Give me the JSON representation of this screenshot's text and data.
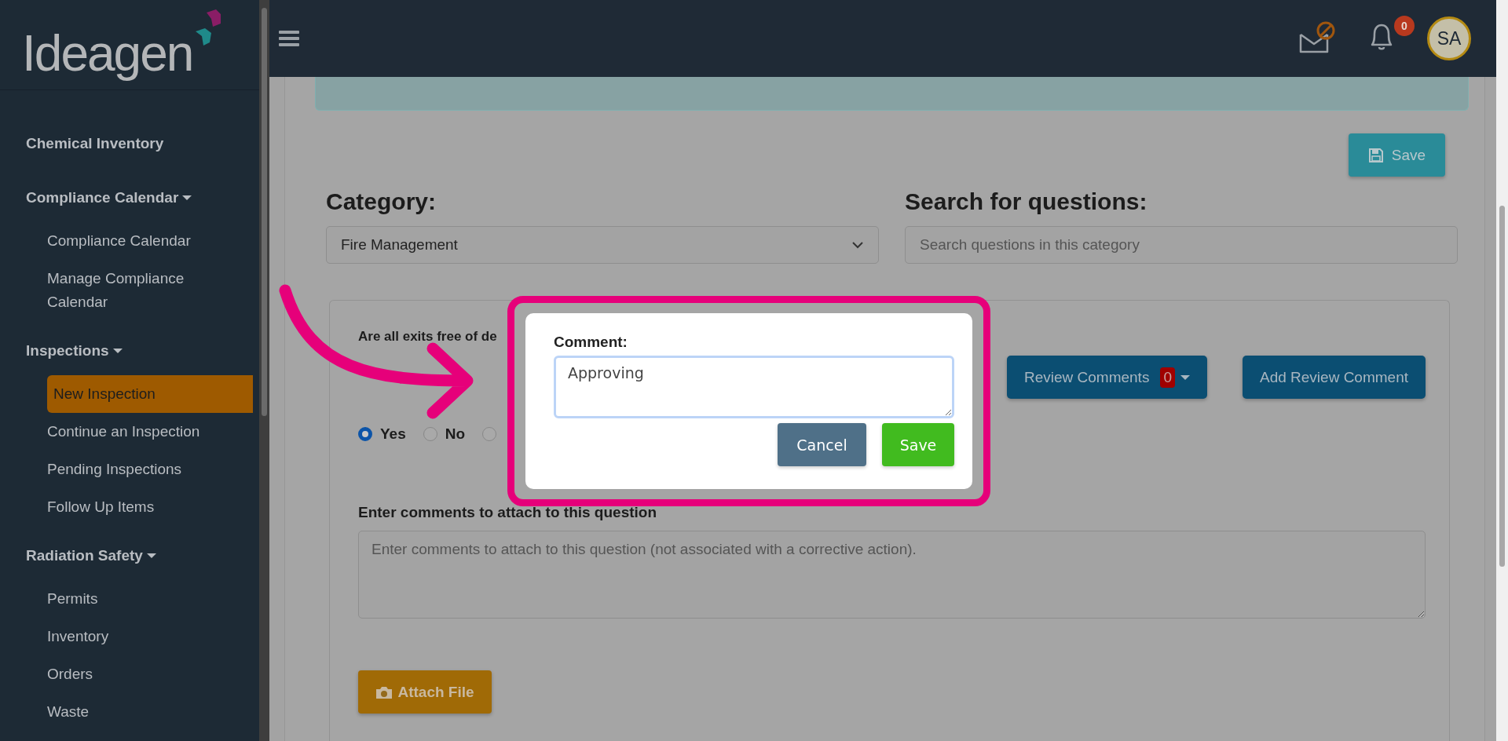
{
  "sidebar": {
    "logo": "Ideagen",
    "sections": [
      {
        "label": "Chemical Inventory",
        "kind": "link"
      },
      {
        "label": "Compliance Calendar",
        "kind": "group",
        "children": [
          {
            "label": "Compliance Calendar",
            "selected": false
          },
          {
            "label": "Manage Compliance Calendar",
            "selected": false
          }
        ]
      },
      {
        "label": "Inspections",
        "kind": "group",
        "children": [
          {
            "label": "New Inspection",
            "selected": true
          },
          {
            "label": "Continue an Inspection",
            "selected": false
          },
          {
            "label": "Pending Inspections",
            "selected": false
          },
          {
            "label": "Follow Up Items",
            "selected": false
          }
        ]
      },
      {
        "label": "Radiation Safety",
        "kind": "group",
        "children": [
          {
            "label": "Permits",
            "selected": false
          },
          {
            "label": "Inventory",
            "selected": false
          },
          {
            "label": "Orders",
            "selected": false
          },
          {
            "label": "Waste",
            "selected": false
          }
        ]
      }
    ]
  },
  "header": {
    "notifications_count": "0",
    "avatar": "SA"
  },
  "form": {
    "save_button": "Save",
    "category": {
      "label": "Category:",
      "value": "Fire Management"
    },
    "search": {
      "label": "Search for questions:",
      "placeholder": "Search questions in this category"
    },
    "question": {
      "text": "Are all exits free of de",
      "review_comments_button": "Review Comments",
      "review_comments_count": "0",
      "add_review_button": "Add Review Comment",
      "answers": [
        {
          "label": "Yes",
          "selected": true
        },
        {
          "label": "No",
          "selected": false
        },
        {
          "selected": false
        }
      ],
      "comments_label": "Enter comments to attach to this question",
      "comments_placeholder": "Enter comments to attach to this question (not associated with a corrective action).",
      "attach_button": "Attach File"
    }
  },
  "dialog": {
    "label": "Comment:",
    "value": "Approving",
    "buttons": [
      {
        "label": "Cancel",
        "kind": "secondary"
      },
      {
        "label": "Save",
        "kind": "primary"
      }
    ]
  }
}
